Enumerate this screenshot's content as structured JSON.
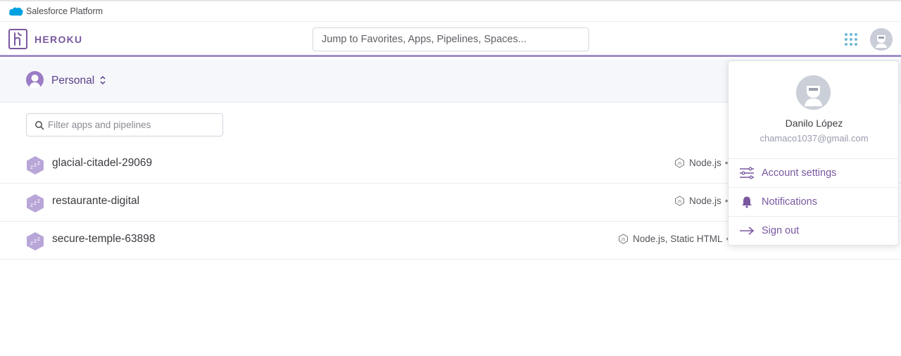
{
  "salesforce_bar": {
    "label": "Salesforce Platform"
  },
  "header": {
    "logo_text": "HEROKU",
    "search_placeholder": "Jump to Favorites, Apps, Pipelines, Spaces..."
  },
  "team_switcher": {
    "label": "Personal"
  },
  "filter": {
    "placeholder": "Filter apps and pipelines"
  },
  "apps": [
    {
      "name": "glacial-citadel-29069",
      "language": "Node.js",
      "separator": "•"
    },
    {
      "name": "restaurante-digital",
      "language": "Node.js",
      "separator": "•"
    },
    {
      "name": "secure-temple-63898",
      "language": "Node.js, Static HTML",
      "separator": "•"
    }
  ],
  "account_menu": {
    "name": "Danilo López",
    "email": "chamaco1037@gmail.com",
    "items": [
      {
        "label": "Account settings",
        "icon": "settings-sliders-icon"
      },
      {
        "label": "Notifications",
        "icon": "bell-icon"
      },
      {
        "label": "Sign out",
        "icon": "arrow-right-icon"
      }
    ]
  },
  "colors": {
    "brand_purple": "#79589f",
    "accent_line": "#a08fc9",
    "apps_grid_dot": "#70b8d4",
    "salesforce_blue": "#00a1e0"
  }
}
